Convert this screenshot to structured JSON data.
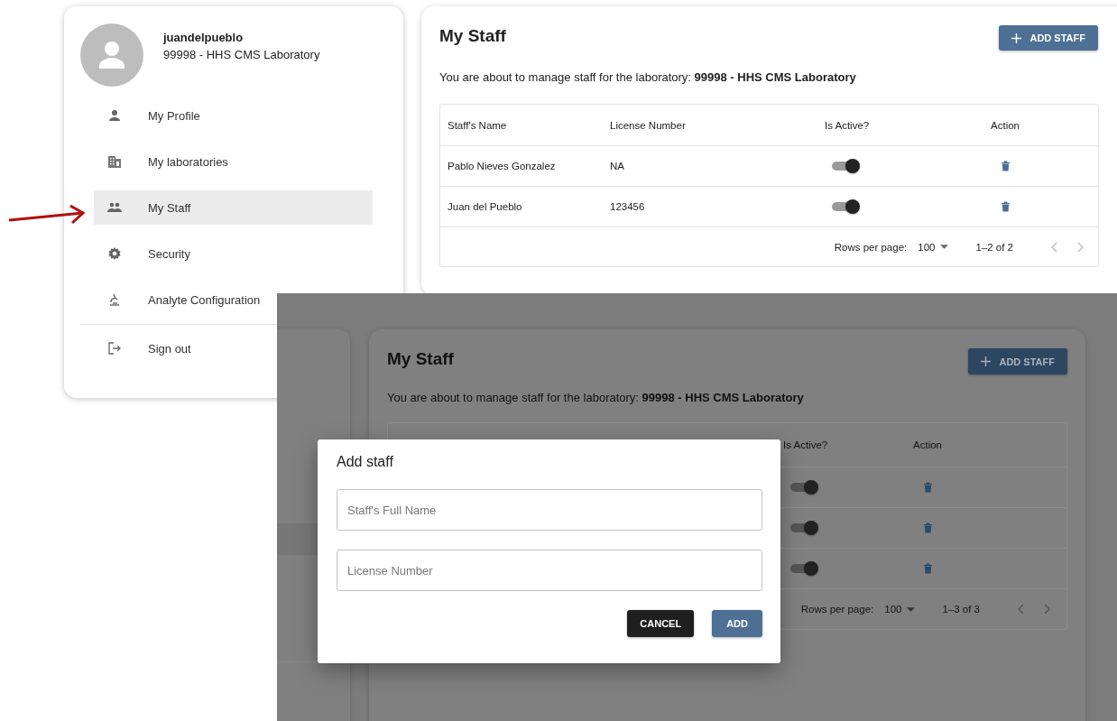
{
  "profile_menu": {
    "username": "juandelpueblo",
    "laboratory": "99998 - HHS CMS Laboratory",
    "items": [
      {
        "label": "My Profile",
        "kind": "person",
        "selected": false
      },
      {
        "label": "My laboratories",
        "kind": "building",
        "selected": false
      },
      {
        "label": "My Staff",
        "kind": "people",
        "selected": true
      },
      {
        "label": "Security",
        "kind": "gear",
        "selected": false
      },
      {
        "label": "Analyte Configuration",
        "kind": "microscope",
        "selected": false
      }
    ],
    "sign_out": "Sign out"
  },
  "staff_page": {
    "title": "My Staff",
    "add_button": "ADD STAFF",
    "intro": "You are about to manage staff for the laboratory: **99998 - HHS CMS Laboratory**",
    "columns": [
      "Staff's Name",
      "License Number",
      "Is Active?",
      "Action"
    ],
    "rows": [
      {
        "name": "Pablo Nieves Gonzalez",
        "license": "NA",
        "active": true
      },
      {
        "name": "Juan del Pueblo",
        "license": "123456",
        "active": true
      }
    ],
    "rows_per_page_label": "Rows per page:",
    "rows_per_page": "100",
    "range": "1–2 of 2"
  },
  "dialog_screen": {
    "page": {
      "title": "My Staff",
      "add_button": "ADD STAFF",
      "intro": "You are about to manage staff for the laboratory: **99998 - HHS CMS Laboratory**",
      "columns": [
        "Is Active?",
        "Action"
      ],
      "rows": [
        {
          "active": true
        },
        {
          "active": true
        },
        {
          "active": true
        }
      ],
      "rows_per_page_label": "Rows per page:",
      "rows_per_page": "100",
      "range": "1–3 of 3"
    },
    "dialog": {
      "title": "Add staff",
      "fields": [
        {
          "placeholder": "Staff's Full Name"
        },
        {
          "placeholder": "License Number"
        }
      ],
      "buttons": [
        {
          "label": "CANCEL",
          "kind": "secondary"
        },
        {
          "label": "ADD",
          "kind": "primary"
        }
      ]
    }
  }
}
